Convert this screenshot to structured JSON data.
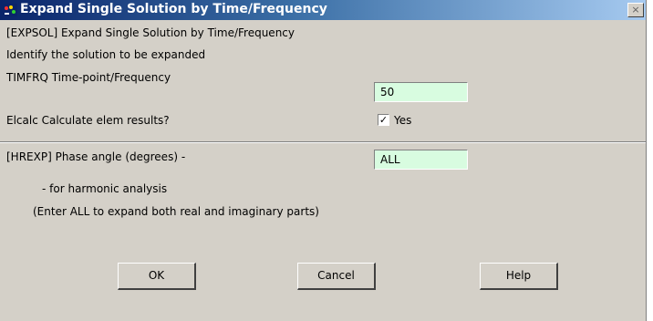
{
  "window": {
    "title": "Expand Single Solution by Time/Frequency",
    "close_glyph": "×"
  },
  "section1": {
    "header": "[EXPSOL]  Expand Single Solution by Time/Frequency",
    "subheader": "Identify the solution to be expanded",
    "timfrq_label": "TIMFRQ  Time-point/Frequency",
    "timfrq_value": "50",
    "elcalc_label": "Elcalc  Calculate elem results?",
    "elcalc_checked": true,
    "elcalc_check_glyph": "✓",
    "elcalc_option_label": "Yes"
  },
  "section2": {
    "hrexp_label": "[HREXP]  Phase angle (degrees) -",
    "hrexp_value": "ALL",
    "note1": "- for harmonic analysis",
    "note2": "(Enter ALL to expand both real and imaginary parts)"
  },
  "buttons": {
    "ok": "OK",
    "cancel": "Cancel",
    "help": "Help"
  },
  "icons": {
    "app": "ansys-app-icon",
    "close": "close-icon",
    "check": "check-icon"
  },
  "colors": {
    "title_bar_start": "#0a246a",
    "title_bar_end": "#a6caf0",
    "dialog_bg": "#d4d0c8",
    "input_bg": "#d8fce0"
  }
}
